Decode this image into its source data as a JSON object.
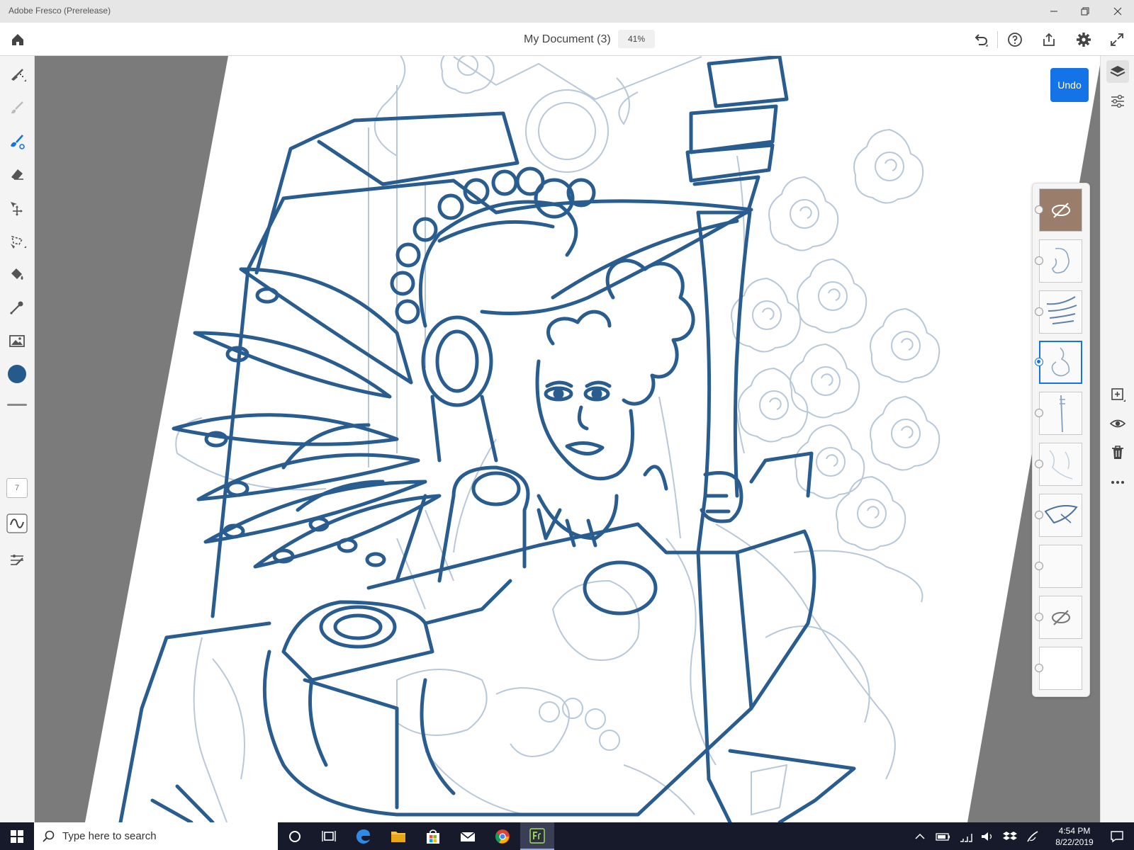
{
  "window": {
    "title": "Adobe Fresco (Prerelease)"
  },
  "document": {
    "name": "My Document (3)",
    "zoom": "41%"
  },
  "canvas": {
    "undo_label": "Undo",
    "brush_color": "#245a8c",
    "ink_color": "#2a5d8f",
    "sketch_color": "#b9c8d9",
    "ui_accent": "#1473e6"
  },
  "tools": {
    "items": [
      "pixel-brush",
      "live-brush",
      "vector-brush",
      "eraser",
      "move-transform",
      "lasso-selection",
      "fill-bucket",
      "eyedropper",
      "place-image",
      "color-swatch"
    ],
    "brush_size": "7"
  },
  "layers": {
    "count": 10,
    "active_index": 3,
    "items": [
      {
        "kind": "image",
        "hidden": true
      },
      {
        "kind": "pixel",
        "hidden": false
      },
      {
        "kind": "pixel",
        "hidden": false
      },
      {
        "kind": "pixel",
        "hidden": false,
        "active": true
      },
      {
        "kind": "pixel",
        "hidden": false
      },
      {
        "kind": "pixel",
        "hidden": false
      },
      {
        "kind": "pixel",
        "hidden": false
      },
      {
        "kind": "live",
        "hidden": false
      },
      {
        "kind": "live",
        "hidden": true
      },
      {
        "kind": "image",
        "hidden": false
      }
    ]
  },
  "taskbar": {
    "search_placeholder": "Type here to search",
    "time": "4:54 PM",
    "date": "8/22/2019"
  }
}
